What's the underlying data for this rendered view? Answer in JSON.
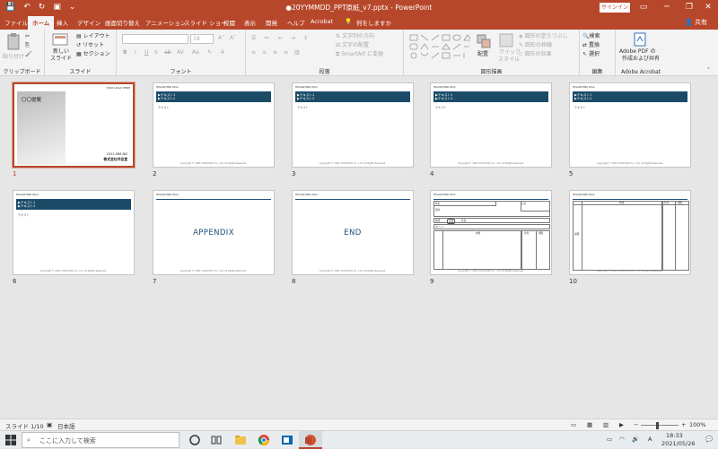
{
  "titlebar": {
    "doc_title": "●20YYMMDD_PPT原紙_v7.pptx  -  PowerPoint",
    "signin": "サインイン",
    "minimize": "─",
    "restore": "❐",
    "close": "✕",
    "ribbon_display": "▭"
  },
  "tabs": [
    {
      "label": "ファイル"
    },
    {
      "label": "ホーム"
    },
    {
      "label": "挿入"
    },
    {
      "label": "デザイン"
    },
    {
      "label": "画面切り替え"
    },
    {
      "label": "アニメーション"
    },
    {
      "label": "スライド ショー"
    },
    {
      "label": "校閲"
    },
    {
      "label": "表示"
    },
    {
      "label": "開発"
    },
    {
      "label": "ヘルプ"
    },
    {
      "label": "Acrobat"
    }
  ],
  "tellme": "何をしますか",
  "share": "共有",
  "ribbon": {
    "clipboard": {
      "name": "クリップボード",
      "paste": "貼り付け"
    },
    "slides": {
      "name": "スライド",
      "new_slide": "新しい",
      "new_slide2": "スライド",
      "layout": "レイアウト",
      "reset": "リセット",
      "section": "セクション"
    },
    "font": {
      "name": "フォント",
      "size": "18"
    },
    "paragraph": {
      "name": "段落",
      "text_direction": "文字列の方向",
      "align_text": "文字の配置",
      "smartart": "SmartArt に変換"
    },
    "drawing": {
      "name": "図形描画",
      "arrange": "配置",
      "quick_styles": "クイック",
      "quick_styles2": "スタイル",
      "fill": "図形の塗りつぶし",
      "outline": "図形の枠線",
      "effects": "図形の効果"
    },
    "editing": {
      "name": "編集",
      "find": "検索",
      "replace": "置換",
      "select": "選択"
    },
    "acrobat": {
      "name": "Adobe Acrobat",
      "create1": "Adobe PDF の",
      "create2": "作成および共有"
    }
  },
  "slides": [
    {
      "num": "1",
      "selected": true,
      "kind": "cover",
      "title": "〇〇提案",
      "date": "2021-MM-DD",
      "corp": "株式会社弁吉堂",
      "logo_small": "YOUR LOGO HERE"
    },
    {
      "num": "2",
      "kind": "content",
      "logo": "HIGASHINO DIGI",
      "band1": "▶テキスト1",
      "band2": "▶テキスト2",
      "body": "テキスト",
      "footer": "Copyright © 2021 XXXXXXXX Co., Ltd. All Rights Reserved."
    },
    {
      "num": "3",
      "kind": "content",
      "logo": "HIGASHINO DIGI",
      "band1": "▶テキスト1",
      "band2": "▶テキスト2",
      "body": "テキスト",
      "footer": "Copyright © 2021 XXXXXXXX Co., Ltd. All Rights Reserved."
    },
    {
      "num": "4",
      "kind": "content",
      "logo": "HIGASHINO DIGI",
      "band1": "▶テキスト1",
      "band2": "▶テキスト2",
      "body": "テキスト",
      "footer": "Copyright © 2021 XXXXXXXX Co., Ltd. All Rights Reserved."
    },
    {
      "num": "5",
      "kind": "content",
      "logo": "HIGASHINO DIGI",
      "band1": "▶テキスト1",
      "band2": "▶テキスト2",
      "body": "テキスト",
      "footer": "Copyright © 2021 XXXXXXXX Co., Ltd. All Rights Reserved."
    },
    {
      "num": "6",
      "kind": "content",
      "logo": "HIGASHINO DIGI",
      "band1": "▶テキスト1",
      "band2": "▶テキスト2",
      "body": "テキスト",
      "footer": "Copyright © 2021 XXXXXXXX Co., Ltd. All Rights Reserved."
    },
    {
      "num": "7",
      "kind": "section",
      "logo": "HIGASHINO DIGI",
      "big": "APPENDIX",
      "footer": "Copyright © 2021 XXXXXXXX Co., Ltd. All Rights Reserved."
    },
    {
      "num": "8",
      "kind": "section",
      "logo": "HIGASHINO DIGI",
      "big": "END",
      "footer": "Copyright © 2021 XXXXXXXX Co., Ltd. All Rights Reserved."
    },
    {
      "num": "9",
      "kind": "form",
      "logo": "HIGASHINO DIGI",
      "label_a": "件名",
      "label_b": "日付",
      "label_c": "目的",
      "label_d": "範囲",
      "label_e": "内容",
      "label_f": "担当",
      "label_g": "期限",
      "label_h": "ポイント",
      "label_i": "必要",
      "label_j": "任意",
      "footer": "Copyright © 2021 XXXXXXXX Co., Ltd. All Rights Reserved."
    },
    {
      "num": "10",
      "kind": "table",
      "logo": "HIGASHINO DIGI",
      "col1": "内容",
      "col2": "担当",
      "col3": "期限",
      "row_label": "詳細",
      "footer": "Copyright © 2021 XXXXXXXX Co., Ltd. All Rights Reserved."
    }
  ],
  "statusbar": {
    "slide": "スライド 1/10",
    "lang": "日本語",
    "zoom": "100%"
  },
  "taskbar": {
    "search_placeholder": "ここに入力して検索",
    "time": "18:33",
    "date": "2021/05/26",
    "ime": "A"
  },
  "colors": {
    "accent": "#b7472a",
    "band": "#1b4b66",
    "section_text": "#1f4e79"
  }
}
